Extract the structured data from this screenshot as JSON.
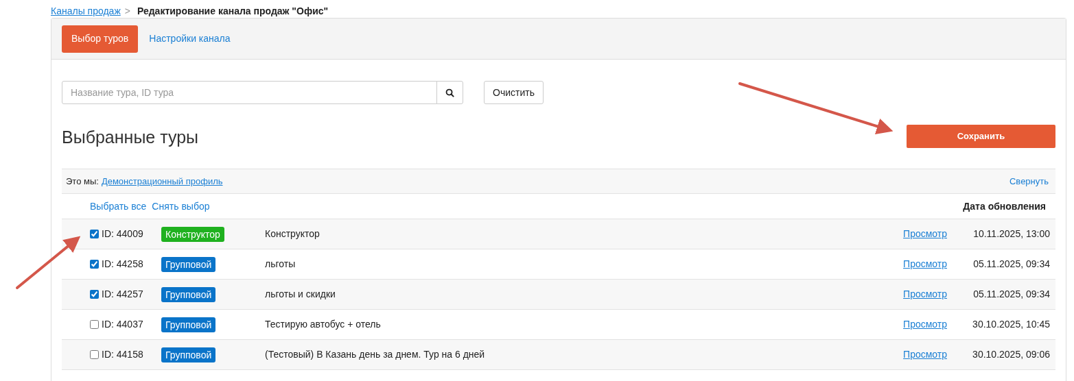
{
  "breadcrumb": {
    "link": "Каналы продаж",
    "separator": ">",
    "current": "Редактирование канала продаж \"Офис\""
  },
  "tabs": [
    {
      "label": "Выбор туров",
      "selected": true
    },
    {
      "label": "Настройки канала",
      "selected": false
    }
  ],
  "search": {
    "placeholder": "Название тура, ID тура"
  },
  "clear_button": "Очистить",
  "heading": "Выбранные туры",
  "save_button": "Сохранить",
  "group": {
    "prefix": "Это мы:",
    "profile_link": "Демонстрационный профиль",
    "collapse_link": "Свернуть"
  },
  "select_all": "Выбрать все",
  "deselect": "Снять выбор",
  "date_header": "Дата обновления",
  "rows": [
    {
      "checked": true,
      "id": "ID: 44009",
      "tag": "Конструктор",
      "color": "#1fb11f",
      "name": "Конструктор",
      "view": "Просмотр",
      "date": "10.11.2025, 13:00"
    },
    {
      "checked": true,
      "id": "ID: 44258",
      "tag": "Групповой",
      "color": "#0a74c9",
      "name": "льготы",
      "view": "Просмотр",
      "date": "05.11.2025, 09:34"
    },
    {
      "checked": true,
      "id": "ID: 44257",
      "tag": "Групповой",
      "color": "#0a74c9",
      "name": "льготы и скидки",
      "view": "Просмотр",
      "date": "05.11.2025, 09:34"
    },
    {
      "checked": false,
      "id": "ID: 44037",
      "tag": "Групповой",
      "color": "#0a74c9",
      "name": "Тестирую автобус + отель",
      "view": "Просмотр",
      "date": "30.10.2025, 10:45"
    },
    {
      "checked": false,
      "id": "ID: 44158",
      "tag": "Групповой",
      "color": "#0a74c9",
      "name": "(Тестовый) В Казань день за днем. Тур на 6 дней",
      "view": "Просмотр",
      "date": "30.10.2025, 09:06"
    }
  ]
}
